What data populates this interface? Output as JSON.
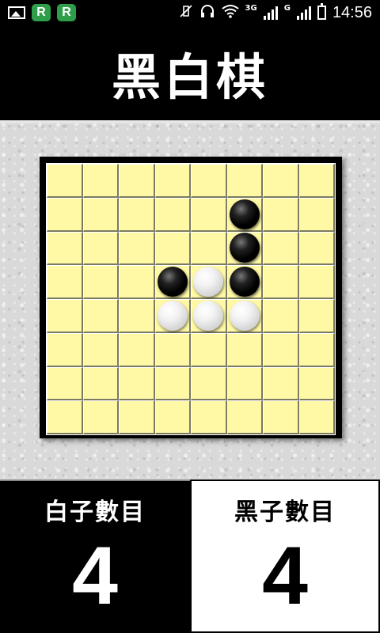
{
  "status_bar": {
    "icons": [
      "gallery-icon",
      "app-r-icon",
      "app-r-icon",
      "mute-vibrate-icon",
      "headphones-icon",
      "wifi-icon",
      "signal-icon",
      "signal-icon",
      "battery-icon"
    ],
    "app_badge_1": "R",
    "app_badge_2": "R",
    "network_1": "3G",
    "network_2": "G",
    "time": "14:56"
  },
  "title": "黑白棋",
  "board": {
    "rows": 8,
    "cols": 8,
    "colors": {
      "board": "#fff9a6",
      "frame": "#000000"
    },
    "cells": [
      [
        "",
        "",
        "",
        "",
        "",
        "",
        "",
        ""
      ],
      [
        "",
        "",
        "",
        "",
        "",
        "B",
        "",
        ""
      ],
      [
        "",
        "",
        "",
        "",
        "",
        "B",
        "",
        ""
      ],
      [
        "",
        "",
        "",
        "B",
        "W",
        "B",
        "",
        ""
      ],
      [
        "",
        "",
        "",
        "W",
        "W",
        "W",
        "",
        ""
      ],
      [
        "",
        "",
        "",
        "",
        "",
        "",
        "",
        ""
      ],
      [
        "",
        "",
        "",
        "",
        "",
        "",
        "",
        ""
      ],
      [
        "",
        "",
        "",
        "",
        "",
        "",
        "",
        ""
      ]
    ]
  },
  "scores": {
    "white": {
      "label": "白子數目",
      "value": "4"
    },
    "black": {
      "label": "黑子數目",
      "value": "4"
    }
  }
}
